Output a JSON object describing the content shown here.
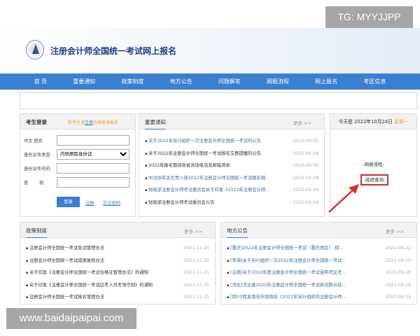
{
  "watermarks": {
    "top": "TG: MYYJJPP",
    "bottom": "www.baidaipaipai.com"
  },
  "header": {
    "title": "注册会计师全国统一考试网上报名"
  },
  "nav": [
    "首 页",
    "重要通知",
    "政策制度",
    "地方公告",
    "问题解答",
    "网报流程",
    "网上报名",
    "考区信息"
  ],
  "login": {
    "title": "考生登录",
    "hint_pre": "新考生请",
    "hint_link": "注册",
    "hint_post": "后再登录报名",
    "fields": [
      {
        "label": "中文  姓名",
        "value": ""
      },
      {
        "label": "身份证件类型",
        "value": "内地居民身份证"
      },
      {
        "label": "身份证件号码",
        "value": ""
      },
      {
        "label": "密        码",
        "value": ""
      }
    ],
    "login_button": "登录",
    "register_link": "注册",
    "forgot_link": "忘记密码"
  },
  "notices": {
    "title": "重要通知",
    "more": "更多 >>",
    "items": [
      {
        "title": "关于2022年另行组织一次注册会计师全国统一考试的公告",
        "date": "2022-09-05",
        "blue": true
      },
      {
        "title": "关于2022年注册会计师全国统一考试报名交费提醒的公告",
        "date": "2022-06-28",
        "blue": false
      },
      {
        "title": "2022年报名期间各省咨询电话及邮箱清单",
        "date": "2022-04-06",
        "blue": false
      },
      {
        "title": "中注协有关负责人就2022年注册会计师全国统一考试报名相...",
        "date": "2022-02-28",
        "blue": true
      },
      {
        "title": "财政部注册会计师考试委员会关于印发《2022年注册会计师...",
        "date": "2022-02-28",
        "blue": true
      },
      {
        "title": "财政部注册会计师考试委员会公告",
        "date": "2022-02-28",
        "blue": false
      }
    ]
  },
  "today": {
    "prefix": "今天是 2022年10月24日",
    "weekday": "星期一",
    "links": [
      "-网报流程-",
      "-成绩查询-"
    ]
  },
  "policy": {
    "title": "政策制度",
    "more": "更多 >>",
    "items": [
      {
        "title": "注册会计师全国统一考试免试管理办法",
        "date": "2021-11-25"
      },
      {
        "title": "注册会计师全国统一考试成绩复核办法",
        "date": "2021-11-25"
      },
      {
        "title": "关于印发《注册会计师全国统一考试合格证管理办法》的通知",
        "date": "2021-11-25"
      },
      {
        "title": "关于印发《注册会计师全国统一考试应考人员考场守则》的通知",
        "date": "2021-11-25"
      },
      {
        "title": "注册会计师全国统一考试报名管理办法",
        "date": "2021-11-25"
      }
    ]
  },
  "local": {
    "title": "地方公告",
    "more": "更多 >>",
    "items": [
      {
        "title": "[重庆]2022年注册会计师全国统一考试（重庆地区） 相...",
        "date": "2022-09-22"
      },
      {
        "title": "[青海]关于另行组织一次2022年注册会计师全国统一考试...",
        "date": "2022-09-19"
      },
      {
        "title": "[云南]关于2022年度注册会计师全国统一考试昆明考区考...",
        "date": "2022-09-19"
      },
      {
        "title": "[河北]河北省2022年注册会计师全国统一考试新冠肺炎疫...",
        "date": "2022-09-19"
      },
      {
        "title": "[四川]转发南充市财政局《2022年另行组织的注册会计师...",
        "date": "2022-09-19"
      }
    ]
  },
  "colors": {
    "nav": "#3b7fd0",
    "accent": "#e6a23c",
    "highlight": "#c9302c"
  }
}
